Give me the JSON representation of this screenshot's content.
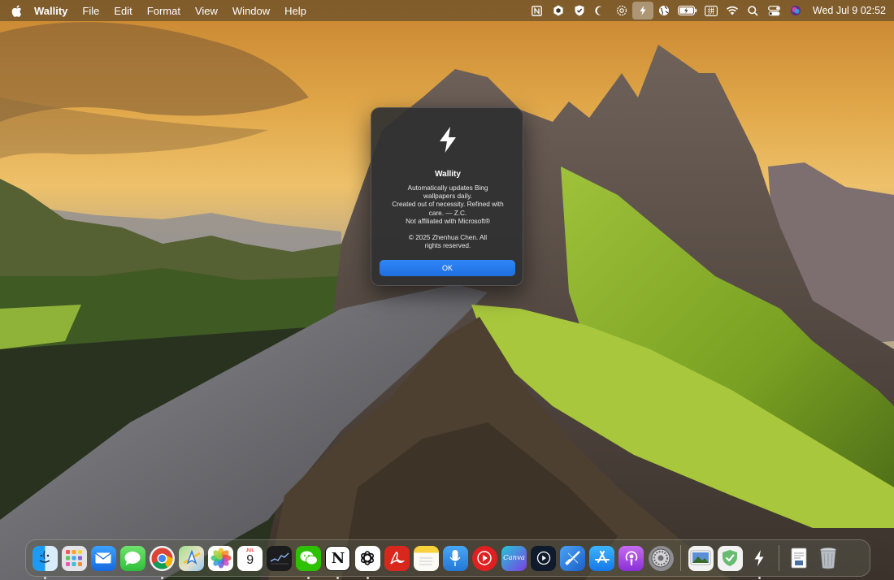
{
  "menubar": {
    "app_name": "Wallity",
    "menus": [
      "File",
      "Edit",
      "Format",
      "View",
      "Window",
      "Help"
    ],
    "clock": "Wed Jul 9  02:52",
    "status_icons": [
      "notion-icon",
      "perplexity-icon",
      "shield-check-icon",
      "moon-icon",
      "settings-gear-icon",
      "wallity-bolt-icon",
      "globe-icon",
      "battery-icon",
      "input-method-icon",
      "wifi-icon",
      "search-icon",
      "control-center-icon",
      "siri-icon"
    ],
    "battery_label": "⚡",
    "input_method_label": "拼"
  },
  "alert": {
    "icon": "bolt-icon",
    "title": "Wallity",
    "body_lines": [
      "Automatically updates Bing",
      "wallpapers daily.",
      "Created out of necessity. Refined with",
      "care. — Z.C.",
      "Not affiliated with Microsoft®"
    ],
    "copyright_lines": [
      "© 2025 Zhenhua Chen. All",
      "rights reserved."
    ],
    "ok_label": "OK",
    "accent_color": "#2a7ef0"
  },
  "dock": {
    "items": [
      {
        "name": "finder",
        "label": "☺",
        "running": true
      },
      {
        "name": "launchpad",
        "label": "",
        "running": false
      },
      {
        "name": "mail",
        "label": "✉",
        "running": false
      },
      {
        "name": "messages",
        "label": "💬",
        "running": false
      },
      {
        "name": "chrome",
        "label": "",
        "running": true
      },
      {
        "name": "maps",
        "label": "A",
        "running": false
      },
      {
        "name": "photos",
        "label": "",
        "running": false
      },
      {
        "name": "calendar",
        "label": "9",
        "month": "JUL",
        "running": false
      },
      {
        "name": "stocks",
        "label": "",
        "running": false
      },
      {
        "name": "wechat",
        "label": "",
        "running": true
      },
      {
        "name": "notion",
        "label": "N",
        "running": true
      },
      {
        "name": "chatgpt",
        "label": "",
        "running": true
      },
      {
        "name": "acrobat",
        "label": "A",
        "running": false
      },
      {
        "name": "notes",
        "label": "",
        "running": false
      },
      {
        "name": "voice-memos",
        "label": "",
        "running": false
      },
      {
        "name": "youtube",
        "label": "▶",
        "running": false
      },
      {
        "name": "canva",
        "label": "Canva",
        "running": false
      },
      {
        "name": "prime-video",
        "label": "▶",
        "running": false
      },
      {
        "name": "xcode",
        "label": "",
        "running": false
      },
      {
        "name": "app-store",
        "label": "A",
        "running": false
      },
      {
        "name": "podcasts",
        "label": "",
        "running": false
      },
      {
        "name": "system-settings",
        "label": "",
        "running": false
      }
    ],
    "right_items": [
      {
        "name": "preview",
        "label": "",
        "running": false
      },
      {
        "name": "adguard",
        "label": "",
        "running": false
      },
      {
        "name": "wallity",
        "label": "⚡",
        "running": true
      }
    ],
    "trash_items": [
      {
        "name": "downloads",
        "label": "",
        "running": false
      },
      {
        "name": "trash",
        "label": "",
        "running": false
      }
    ]
  }
}
